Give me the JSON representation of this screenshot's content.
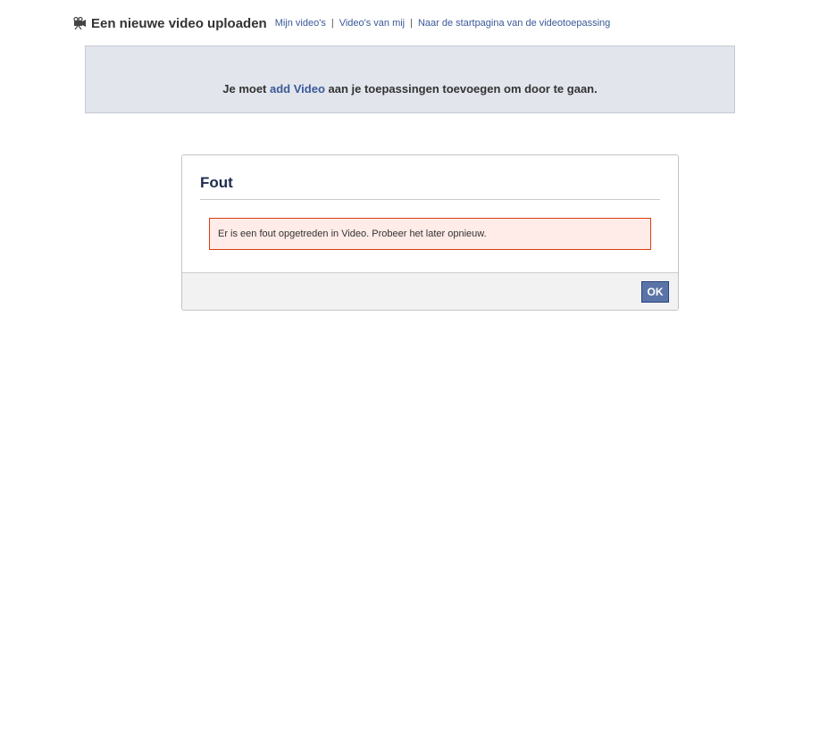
{
  "header": {
    "icon": "video-camera-icon",
    "title": "Een nieuwe video uploaden",
    "nav": [
      {
        "label": "Mijn video's"
      },
      {
        "label": "Video's van mij"
      },
      {
        "label": "Naar de startpagina van de videotoepassing"
      }
    ],
    "separator": "|"
  },
  "notice": {
    "prefix": "Je moet ",
    "link": "add Video",
    "suffix": " aan je toepassingen toevoegen om door te gaan."
  },
  "dialog": {
    "title": "Fout",
    "error_message": "Er is een fout opgetreden in Video. Probeer het later opnieuw.",
    "ok_label": "OK"
  },
  "colors": {
    "link": "#3b5998",
    "error_bg": "#ffebe8",
    "error_border": "#dd3c10",
    "notice_bg": "#e2e5ec",
    "button_bg": "#5b74a8"
  }
}
